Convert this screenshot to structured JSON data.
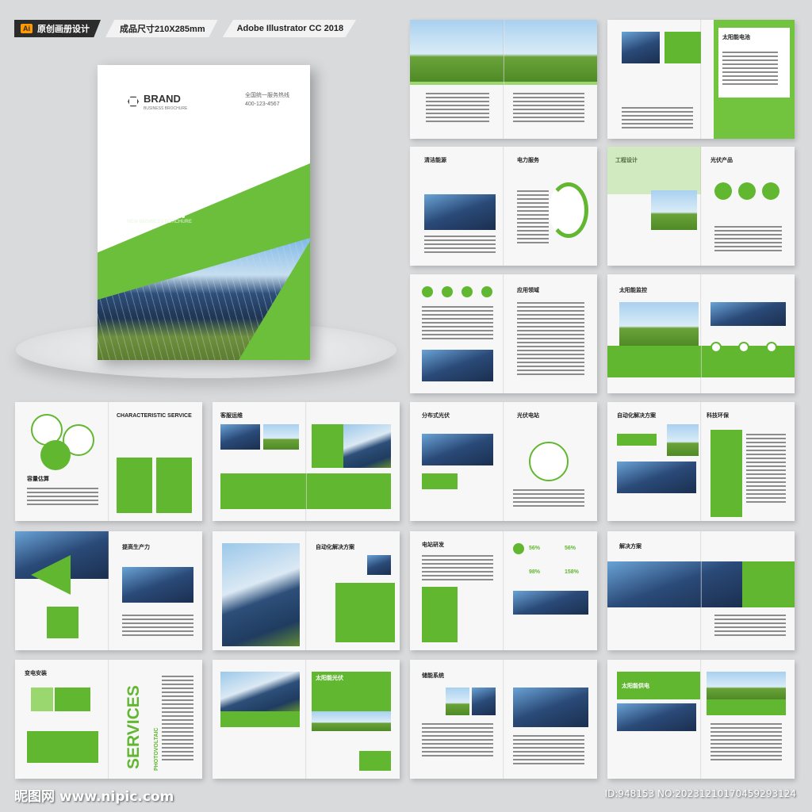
{
  "topbar": {
    "ai_badge": "Ai",
    "tag1": "原创画册设计",
    "tag2": "成品尺寸210X285mm",
    "tag3": "Adobe Illustrator CC 2018"
  },
  "cover": {
    "brand": "BRAND",
    "brand_sub": "BUSINESS BROCHURE",
    "hotline_label": "全国统一服务热线",
    "hotline_number": "400-123-4567",
    "en_line1": "CREATIVE",
    "en_line2": "ARTIST NEW",
    "en_line3": "BUSINESS BROCHER",
    "cn_title": "新能源画册",
    "cn_subtitle": "NEW BUSINESS BORCHURE"
  },
  "spreads": {
    "s2": "太阳能电池",
    "s3a": "清洁能源",
    "s3b": "电力服务",
    "s4a": "工程设计",
    "s4b": "光伏产品",
    "s5": "应用领域",
    "s6": "太阳能监控",
    "s7a": "CHARACTERISTIC SERVICE",
    "s7b": "容量估算",
    "s8": "客服运维",
    "s9a": "分布式光伏",
    "s9b": "光伏电站",
    "s10a": "自动化解决方案",
    "s10b": "科技环保",
    "s11": "提高生产力",
    "s12": "自动化解决方案",
    "s13": "电站研发",
    "s13_p1": "56%",
    "s13_p2": "56%",
    "s13_p3": "98%",
    "s13_p4": "158%",
    "s14": "解决方案",
    "s15a": "变电安装",
    "s15b": "SERVICES",
    "s15c": "PHOTOVOLTAIC",
    "s16": "太阳能光伏",
    "s17": "储能系统",
    "s18": "太阳能供电"
  },
  "watermark": "昵图网 www.nipic.com",
  "image_id": "ID:948153 NO:20231210170459293124",
  "colors": {
    "accent": "#62b731",
    "accent_light": "#9ad86f"
  }
}
